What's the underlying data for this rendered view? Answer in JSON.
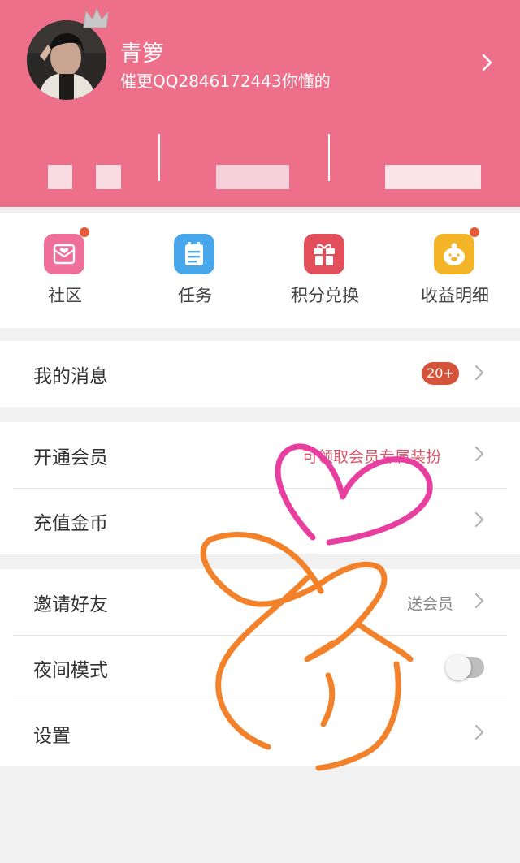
{
  "profile": {
    "name": "青箩",
    "signature": "催更QQ2846172443你懂的"
  },
  "quick_actions": [
    {
      "label": "社区",
      "icon": "heart-card-icon",
      "color": "#ee6f99",
      "has_dot": true
    },
    {
      "label": "任务",
      "icon": "clipboard-icon",
      "color": "#48a7ea",
      "has_dot": false
    },
    {
      "label": "积分兑换",
      "icon": "gift-icon",
      "color": "#e24f5b",
      "has_dot": false
    },
    {
      "label": "收益明细",
      "icon": "piggy-bank-icon",
      "color": "#f3b427",
      "has_dot": true
    }
  ],
  "menu": {
    "messages": {
      "label": "我的消息",
      "badge": "20+"
    },
    "vip": {
      "label": "开通会员",
      "hint": "可领取会员专属装扮"
    },
    "recharge": {
      "label": "充值金币"
    },
    "invite": {
      "label": "邀请好友",
      "hint": "送会员"
    },
    "night_mode": {
      "label": "夜间模式",
      "enabled": false
    },
    "settings": {
      "label": "设置"
    }
  },
  "colors": {
    "header_pink": "#ee6f8a",
    "badge_red": "#d6533b",
    "vip_hint": "#d9566a",
    "doodle_heart": "#e83ea0",
    "doodle_hand": "#f2812a"
  }
}
